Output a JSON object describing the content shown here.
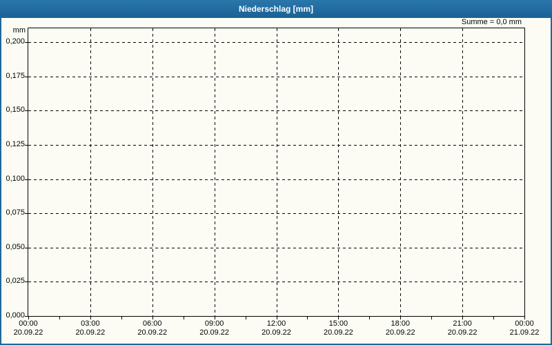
{
  "window": {
    "title": "Niederschlag [mm]"
  },
  "summary": {
    "label": "Summe = 0,0 mm"
  },
  "axis": {
    "unit": "mm"
  },
  "chart_data": {
    "type": "line",
    "title": "Niederschlag [mm]",
    "subtitle": "Summe = 0,0 mm",
    "xlabel": "",
    "ylabel": "mm",
    "grid": true,
    "legend_position": "none",
    "ylim": [
      0.0,
      0.21
    ],
    "y_tick_step": 0.025,
    "y_ticks": [
      {
        "label": "0,200",
        "value": 0.2
      },
      {
        "label": "0,175",
        "value": 0.175
      },
      {
        "label": "0,150",
        "value": 0.15
      },
      {
        "label": "0,125",
        "value": 0.125
      },
      {
        "label": "0,100",
        "value": 0.1
      },
      {
        "label": "0,075",
        "value": 0.075
      },
      {
        "label": "0,050",
        "value": 0.05
      },
      {
        "label": "0,025",
        "value": 0.025
      },
      {
        "label": "0,000",
        "value": 0.0
      }
    ],
    "x_ticks": [
      {
        "time": "00:00",
        "date": "20.09.22"
      },
      {
        "time": "03:00",
        "date": "20.09.22"
      },
      {
        "time": "06:00",
        "date": "20.09.22"
      },
      {
        "time": "09:00",
        "date": "20.09.22"
      },
      {
        "time": "12:00",
        "date": "20.09.22"
      },
      {
        "time": "15:00",
        "date": "20.09.22"
      },
      {
        "time": "18:00",
        "date": "20.09.22"
      },
      {
        "time": "21:00",
        "date": "20.09.22"
      },
      {
        "time": "00:00",
        "date": "21.09.22"
      }
    ],
    "x_minor_ticks_per_interval": 2,
    "series": [
      {
        "name": "Niederschlag",
        "values": [],
        "sum_mm": 0.0
      }
    ],
    "colors": {
      "titlebar_top": "#2a77ab",
      "titlebar_bottom": "#1a6195",
      "title_text": "#ffffff",
      "page_border": "#21689c",
      "background": "#fcfcf5",
      "grid": "#000000",
      "text": "#000000"
    }
  }
}
